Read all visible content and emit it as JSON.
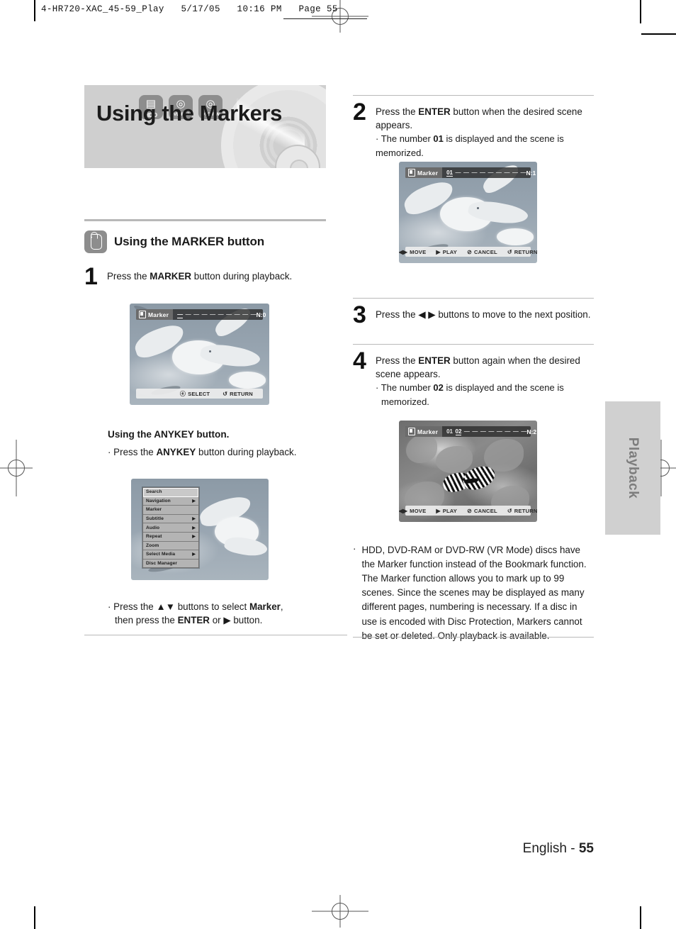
{
  "slug": "4-HR720-XAC_45-59_Play   5/17/05   10:16 PM   Page 55",
  "banner": {
    "title": "Using the Markers"
  },
  "media_badges": [
    {
      "name": "hdd-badge",
      "label": "HDD",
      "glyph": "▤"
    },
    {
      "name": "dvd-ram-badge",
      "label": "DVD-RAM",
      "glyph": "◎"
    },
    {
      "name": "dvd-rw-badge",
      "label": "DVD-RW",
      "glyph": "◎"
    }
  ],
  "vr_mode_note": "(VR mode)",
  "section": {
    "heading": "Using the MARKER button"
  },
  "steps": {
    "one": {
      "number": "1",
      "line1_a": "Press the ",
      "line1_b": "MARKER",
      "line1_c": " button during playback."
    },
    "two": {
      "number": "2",
      "line1_a": "Press the ",
      "line1_b": "ENTER",
      "line1_c": " button when the desired scene",
      "line2": "appears.",
      "bullet_a": "· The number ",
      "bullet_b": "01",
      "bullet_c": " is displayed and the scene is memorized."
    },
    "three": {
      "number": "3",
      "line1": "Press the ◀ ▶ buttons to move to the next position."
    },
    "four": {
      "number": "4",
      "line1_a": "Press the ",
      "line1_b": "ENTER",
      "line1_c": " button again when the desired",
      "line2": "scene appears.",
      "bullet_a": "· The number ",
      "bullet_b": "02",
      "bullet_c": " is displayed and the scene is",
      "bullet_d": "memorized."
    }
  },
  "anykey_section": {
    "heading": "Using the ANYKEY button.",
    "bullet_a": "· Press the ",
    "bullet_b": "ANYKEY",
    "bullet_c": " button during playback.",
    "after_a": "· Press the ▲▼ buttons to select ",
    "after_b": "Marker",
    "after_c": ",",
    "after_d": "then press the ",
    "after_e": "ENTER",
    "after_f": " or ▶ button."
  },
  "anykey_menu": {
    "items": [
      {
        "label": "Search",
        "arrow": "",
        "selected": true
      },
      {
        "label": "Navigation",
        "arrow": "▶",
        "selected": false
      },
      {
        "label": "Marker",
        "arrow": "",
        "selected": false
      },
      {
        "label": "Subtitle",
        "arrow": "▶",
        "selected": false
      },
      {
        "label": "Audio",
        "arrow": "▶",
        "selected": false
      },
      {
        "label": "Repeat",
        "arrow": "▶",
        "selected": false
      },
      {
        "label": "Zoom",
        "arrow": "",
        "selected": false
      },
      {
        "label": "Select Media",
        "arrow": "▶",
        "selected": false
      },
      {
        "label": "Disc Manager",
        "arrow": "",
        "selected": false
      }
    ]
  },
  "osd_screens": {
    "screen1": {
      "title": "Marker",
      "slots": [
        "—",
        "—",
        "—",
        "—",
        "—",
        "—",
        "—",
        "—",
        "—",
        "—"
      ],
      "counter": "N:0",
      "footer": [
        {
          "glyph": "ⓔ",
          "label": "SELECT"
        },
        {
          "glyph": "↺",
          "label": "RETURN"
        }
      ]
    },
    "screen2": {
      "title": "Marker",
      "marked": [
        "01"
      ],
      "slots": [
        "—",
        "—",
        "—",
        "—",
        "—",
        "—",
        "—",
        "—",
        "—"
      ],
      "counter": "N:1",
      "footer": [
        {
          "glyph": "◀▶",
          "label": "MOVE"
        },
        {
          "glyph": "▶",
          "label": "PLAY"
        },
        {
          "glyph": "⊘",
          "label": "CANCEL"
        },
        {
          "glyph": "↺",
          "label": "RETURN"
        }
      ]
    },
    "screen3": {
      "title": "Marker",
      "marked": [
        "01",
        "02"
      ],
      "slots": [
        "—",
        "—",
        "—",
        "—",
        "—",
        "—",
        "—",
        "—"
      ],
      "counter": "N:2",
      "footer": [
        {
          "glyph": "◀▶",
          "label": "MOVE"
        },
        {
          "glyph": "▶",
          "label": "PLAY"
        },
        {
          "glyph": "⊘",
          "label": "CANCEL"
        },
        {
          "glyph": "↺",
          "label": "RETURN"
        }
      ]
    }
  },
  "note": {
    "bullet": "·",
    "text": "HDD, DVD-RAM or DVD-RW (VR Mode) discs have the Marker function instead of the Bookmark function. The Marker function allows you to mark up to 99 scenes. Since the scenes may be displayed as many different pages, numbering is necessary. If a disc in use is encoded with Disc Protection, Markers cannot be set or deleted. Only playback is available."
  },
  "side_tab": {
    "label": "Playback"
  },
  "footer": {
    "language": "English - ",
    "page": "55"
  }
}
